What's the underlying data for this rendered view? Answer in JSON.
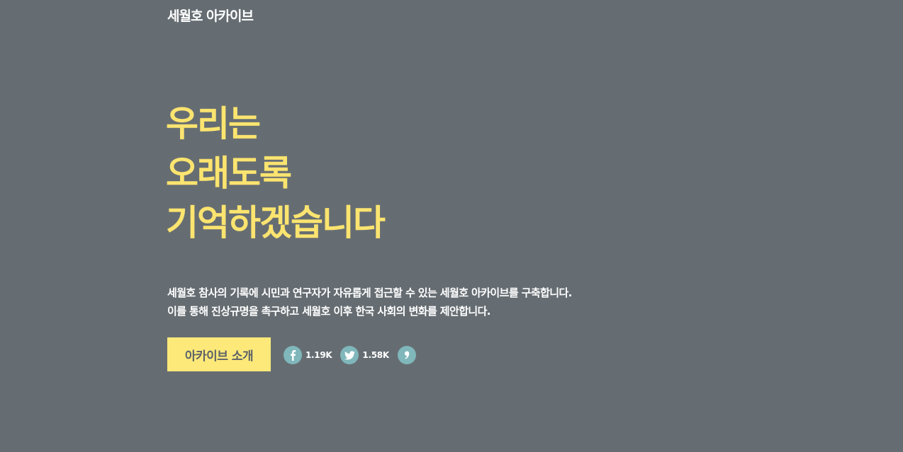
{
  "header": {
    "site_title": "세월호 아카이브"
  },
  "hero": {
    "headline_lines": [
      "우리는",
      "오래도록",
      "기억하겠습니다"
    ],
    "description_lines": [
      "세월호 참사의 기록에 시민과 연구자가 자유롭게 접근할 수 있는 세월호 아카이브를 구축합니다.",
      "이를 통해 진상규명을 촉구하고 세월호 이후 한국 사회의 변화를 제안합니다."
    ],
    "intro_button_label": "아카이브 소개"
  },
  "share": {
    "facebook": {
      "icon": "facebook-icon",
      "count": "1.19K"
    },
    "twitter": {
      "icon": "twitter-icon",
      "count": "1.58K"
    },
    "comment": {
      "icon": "comma-icon"
    }
  },
  "colors": {
    "background": "#666d72",
    "headline": "#fbe46f",
    "button_bg": "#fde979",
    "button_text": "#5c6268",
    "icon_circle": "#7fb7bb",
    "text": "#ffffff"
  }
}
